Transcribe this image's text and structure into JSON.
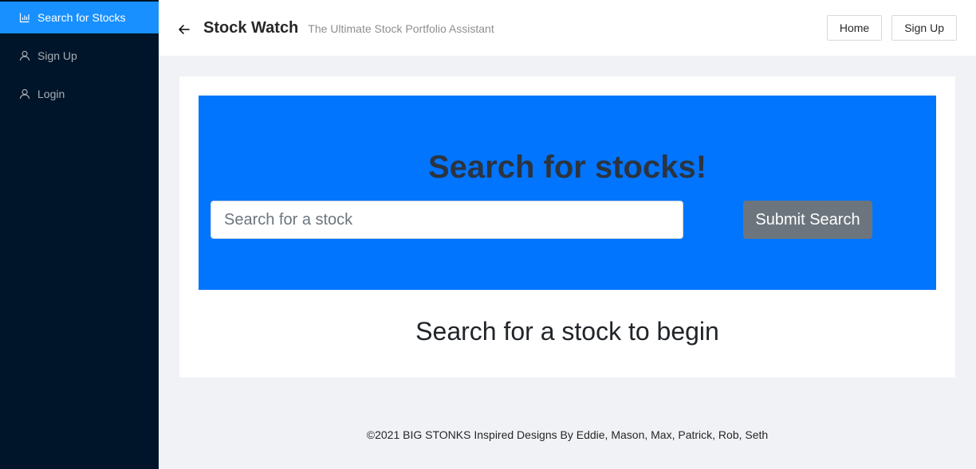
{
  "sidebar": {
    "items": [
      {
        "label": "Search for Stocks",
        "icon": "bar-chart-icon",
        "active": true
      },
      {
        "label": "Sign Up",
        "icon": "user-icon",
        "active": false
      },
      {
        "label": "Login",
        "icon": "user-icon",
        "active": false
      }
    ]
  },
  "header": {
    "title": "Stock Watch",
    "subtitle": "The Ultimate Stock Portfolio Assistant",
    "buttons": {
      "home": "Home",
      "signup": "Sign Up"
    }
  },
  "hero": {
    "title": "Search for stocks!",
    "search_placeholder": "Search for a stock",
    "search_value": "",
    "submit_label": "Submit Search"
  },
  "main": {
    "prompt": "Search for a stock to begin"
  },
  "footer": {
    "text": "©2021 BIG STONKS Inspired Designs By Eddie, Mason, Max, Patrick, Rob, Seth"
  },
  "colors": {
    "sidebar_bg": "#001529",
    "sidebar_active": "#1890ff",
    "hero_bg": "#0275ff",
    "submit_bg": "#6c757d"
  }
}
